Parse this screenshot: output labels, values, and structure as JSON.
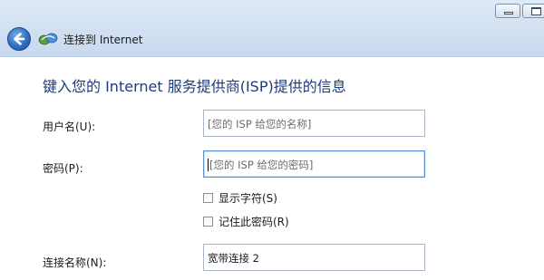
{
  "nav": {
    "title": "连接到 Internet"
  },
  "heading": "键入您的 Internet 服务提供商(ISP)提供的信息",
  "form": {
    "username": {
      "label": "用户名(U):",
      "placeholder": "[您的 ISP 给您的名称]"
    },
    "password": {
      "label": "密码(P):",
      "placeholder": "[您的 ISP 给您的密码]"
    },
    "show_chars": {
      "label": "显示字符(S)",
      "checked": false
    },
    "remember_password": {
      "label": "记住此密码(R)",
      "checked": false
    },
    "connection_name": {
      "label": "连接名称(N):",
      "value": "宽带连接 2"
    }
  },
  "colors": {
    "heading": "#1f3a7a",
    "chrome": "#d3e1f2",
    "back_button": "#2f6fc2"
  },
  "icons": {
    "minimize": "minimize-icon",
    "maximize": "maximize-icon",
    "back": "back-arrow-icon",
    "app": "network-connection-icon"
  }
}
